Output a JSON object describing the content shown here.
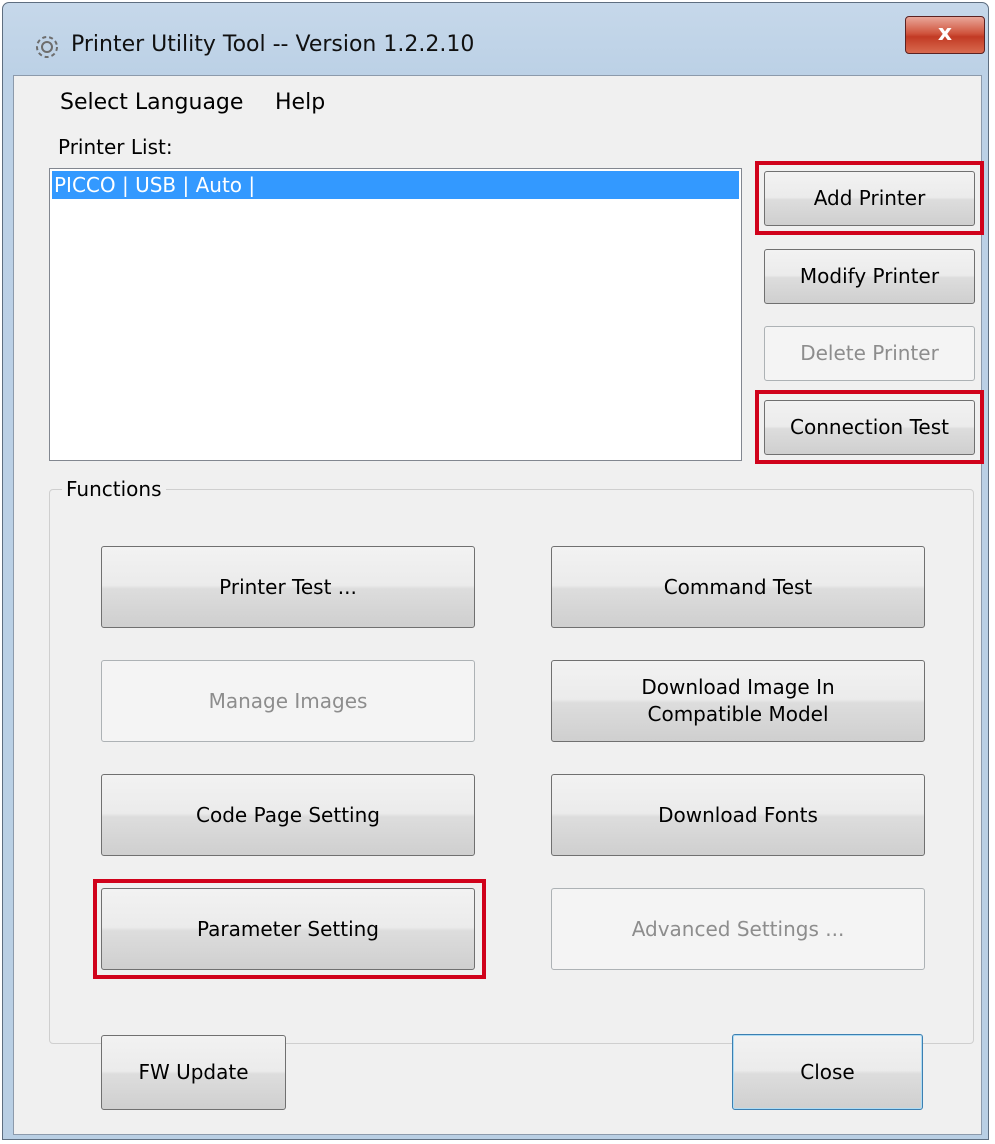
{
  "window": {
    "title": "Printer Utility Tool -- Version 1.2.2.10",
    "close_glyph": "x"
  },
  "menu": {
    "items": [
      "Select Language",
      "Help"
    ]
  },
  "printer_list": {
    "label": "Printer List:",
    "items": [
      "PICCO | USB | Auto |"
    ],
    "selected_index": 0
  },
  "side_buttons": {
    "add": "Add Printer",
    "modify": "Modify Printer",
    "delete": "Delete Printer",
    "connection_test": "Connection Test"
  },
  "functions": {
    "title": "Functions",
    "printer_test": "Printer Test ...",
    "command_test": "Command Test",
    "manage_images": "Manage Images",
    "download_image_line1": "Download Image In",
    "download_image_line2": "Compatible Model",
    "code_page": "Code Page Setting",
    "download_fonts": "Download Fonts",
    "parameter_setting": "Parameter Setting",
    "advanced_settings": "Advanced Settings ..."
  },
  "footer": {
    "fw_update": "FW Update",
    "close": "Close"
  },
  "colors": {
    "highlight": "#d0021b",
    "selection": "#3399ff",
    "title_bar": "#bcd1e6"
  },
  "icons": {
    "app": "gear-icon",
    "close": "close-icon"
  }
}
